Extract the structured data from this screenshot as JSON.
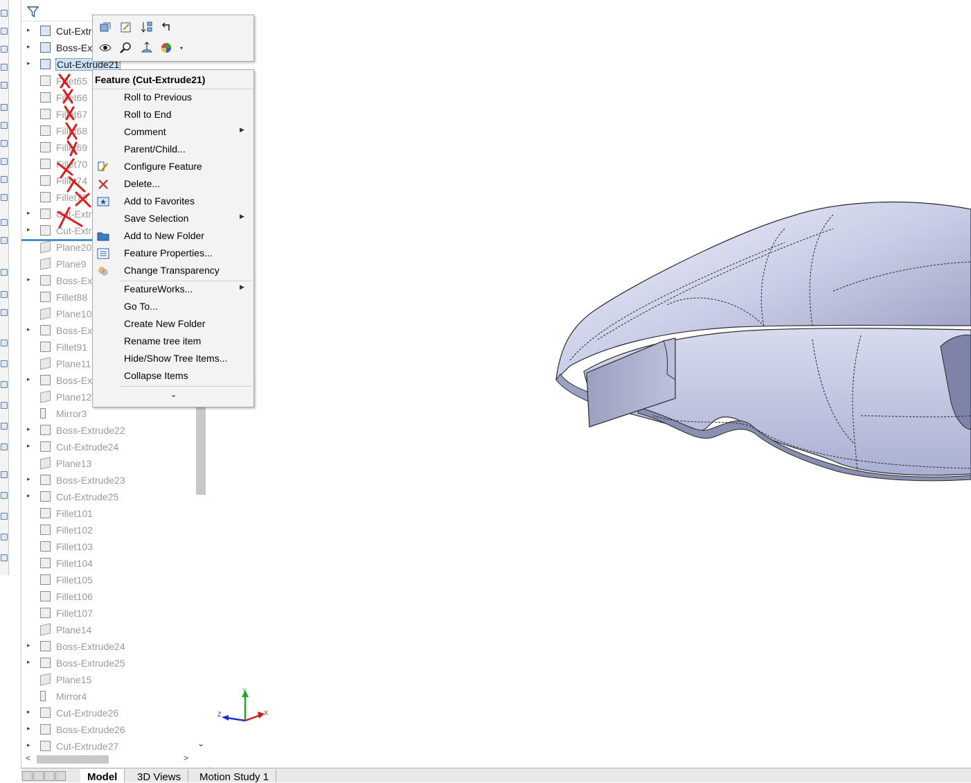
{
  "feature_tree": {
    "items": [
      {
        "label": "Cut-Extr",
        "type": "cut",
        "expander": true,
        "state": "active"
      },
      {
        "label": "Boss-Ex",
        "type": "solid",
        "expander": true,
        "state": "active"
      },
      {
        "label": "Cut-Extrude21",
        "type": "cut",
        "expander": true,
        "state": "selected"
      },
      {
        "label": "Fillet65",
        "type": "fillet",
        "expander": false,
        "state": "suppressed"
      },
      {
        "label": "Fillet66",
        "type": "fillet",
        "expander": false,
        "state": "suppressed"
      },
      {
        "label": "Fillet67",
        "type": "fillet",
        "expander": false,
        "state": "suppressed"
      },
      {
        "label": "Fillet68",
        "type": "fillet",
        "expander": false,
        "state": "suppressed"
      },
      {
        "label": "Fillet69",
        "type": "fillet",
        "expander": false,
        "state": "suppressed"
      },
      {
        "label": "Fillet70",
        "type": "fillet",
        "expander": false,
        "state": "suppressed"
      },
      {
        "label": "Fillet74",
        "type": "fillet",
        "expander": false,
        "state": "suppressed"
      },
      {
        "label": "Fillet76",
        "type": "fillet",
        "expander": false,
        "state": "suppressed"
      },
      {
        "label": "Cut-Extr",
        "type": "cut",
        "expander": true,
        "state": "suppressed"
      },
      {
        "label": "Cut-Extr",
        "type": "cut",
        "expander": true,
        "state": "suppressed"
      },
      {
        "label": "Plane20",
        "type": "plane",
        "expander": false,
        "state": "rolled"
      },
      {
        "label": "Plane9",
        "type": "plane",
        "expander": false,
        "state": "rolled"
      },
      {
        "label": "Boss-Ex",
        "type": "boss",
        "expander": true,
        "state": "rolled"
      },
      {
        "label": "Fillet88",
        "type": "fillet",
        "expander": false,
        "state": "rolled"
      },
      {
        "label": "Plane10",
        "type": "plane",
        "expander": false,
        "state": "rolled"
      },
      {
        "label": "Boss-Ex",
        "type": "boss",
        "expander": true,
        "state": "rolled"
      },
      {
        "label": "Fillet91",
        "type": "fillet",
        "expander": false,
        "state": "rolled"
      },
      {
        "label": "Plane11",
        "type": "plane",
        "expander": false,
        "state": "rolled"
      },
      {
        "label": "Boss-Ex",
        "type": "boss",
        "expander": true,
        "state": "rolled"
      },
      {
        "label": "Plane12",
        "type": "plane",
        "expander": false,
        "state": "rolled"
      },
      {
        "label": "Mirror3",
        "type": "mirror",
        "expander": false,
        "state": "rolled"
      },
      {
        "label": "Boss-Extrude22",
        "type": "boss",
        "expander": true,
        "state": "rolled"
      },
      {
        "label": "Cut-Extrude24",
        "type": "cut",
        "expander": true,
        "state": "rolled"
      },
      {
        "label": "Plane13",
        "type": "plane",
        "expander": false,
        "state": "rolled"
      },
      {
        "label": "Boss-Extrude23",
        "type": "boss",
        "expander": true,
        "state": "rolled"
      },
      {
        "label": "Cut-Extrude25",
        "type": "cut",
        "expander": true,
        "state": "rolled"
      },
      {
        "label": "Fillet101",
        "type": "fillet",
        "expander": false,
        "state": "rolled"
      },
      {
        "label": "Fillet102",
        "type": "fillet",
        "expander": false,
        "state": "rolled"
      },
      {
        "label": "Fillet103",
        "type": "fillet",
        "expander": false,
        "state": "rolled"
      },
      {
        "label": "Fillet104",
        "type": "fillet",
        "expander": false,
        "state": "rolled"
      },
      {
        "label": "Fillet105",
        "type": "fillet",
        "expander": false,
        "state": "rolled"
      },
      {
        "label": "Fillet106",
        "type": "fillet",
        "expander": false,
        "state": "rolled"
      },
      {
        "label": "Fillet107",
        "type": "fillet",
        "expander": false,
        "state": "rolled"
      },
      {
        "label": "Plane14",
        "type": "plane",
        "expander": false,
        "state": "rolled"
      },
      {
        "label": "Boss-Extrude24",
        "type": "boss",
        "expander": true,
        "state": "rolled"
      },
      {
        "label": "Boss-Extrude25",
        "type": "boss",
        "expander": true,
        "state": "rolled"
      },
      {
        "label": "Plane15",
        "type": "plane",
        "expander": false,
        "state": "rolled"
      },
      {
        "label": "Mirror4",
        "type": "mirror",
        "expander": false,
        "state": "rolled"
      },
      {
        "label": "Cut-Extrude26",
        "type": "cut",
        "expander": true,
        "state": "rolled"
      },
      {
        "label": "Boss-Extrude26",
        "type": "boss",
        "expander": true,
        "state": "rolled"
      },
      {
        "label": "Cut-Extrude27",
        "type": "cut",
        "expander": true,
        "state": "rolled"
      }
    ]
  },
  "context_toolbar": {
    "icons": [
      "edit-feature-icon",
      "edit-sketch-icon",
      "rollback-icon",
      "undo-arrow-icon",
      "hide-show-icon",
      "zoom-to-selection-icon",
      "normal-to-icon",
      "appearance-icon"
    ]
  },
  "context_menu": {
    "title": "Feature (Cut-Extrude21)",
    "items": [
      {
        "label": "Roll to Previous",
        "icon": "",
        "submenu": false
      },
      {
        "label": "Roll to End",
        "icon": "",
        "submenu": false
      },
      {
        "label": "Comment",
        "icon": "",
        "submenu": true
      },
      {
        "label": "Parent/Child...",
        "icon": "",
        "submenu": false
      },
      {
        "label": "Configure Feature",
        "icon": "configure-feature-icon",
        "submenu": false
      },
      {
        "label": "Delete...",
        "icon": "delete-icon",
        "submenu": false
      },
      {
        "label": "Add to Favorites",
        "icon": "favorites-icon",
        "submenu": false
      },
      {
        "label": "Save Selection",
        "icon": "",
        "submenu": true
      },
      {
        "label": "Add to New Folder",
        "icon": "folder-icon",
        "submenu": false
      },
      {
        "label": "Feature Properties...",
        "icon": "properties-icon",
        "submenu": false
      },
      {
        "label": "Change Transparency",
        "icon": "transparency-icon",
        "submenu": false
      },
      {
        "label": "FeatureWorks...",
        "icon": "",
        "submenu": true
      },
      {
        "label": "Go To...",
        "icon": "",
        "submenu": false
      },
      {
        "label": "Create New Folder",
        "icon": "",
        "submenu": false
      },
      {
        "label": "Rename tree item",
        "icon": "",
        "submenu": false
      },
      {
        "label": "Hide/Show Tree Items...",
        "icon": "",
        "submenu": false
      },
      {
        "label": "Collapse Items",
        "icon": "",
        "submenu": false
      }
    ],
    "expand_glyph": "⌄"
  },
  "bottom_tabs": [
    {
      "label": "Model",
      "active": true
    },
    {
      "label": "3D Views",
      "active": false
    },
    {
      "label": "Motion Study 1",
      "active": false
    }
  ],
  "triad": {
    "x": "X",
    "y": "Y",
    "z": "Z"
  },
  "colors": {
    "selection": "#cde3f7",
    "rollback_bar": "#4a90c8",
    "model_face": "#c9cde6",
    "delete_red": "#e21a1a"
  }
}
